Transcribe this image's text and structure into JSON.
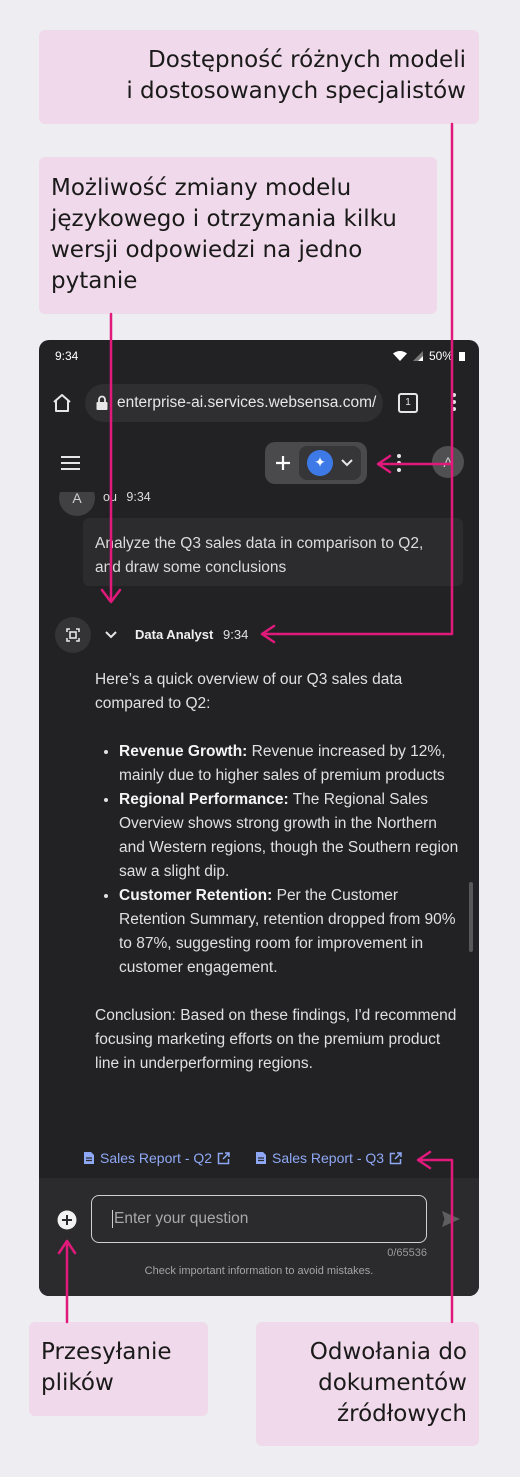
{
  "callouts": {
    "models": {
      "line1": "Dostępność różnych modeli",
      "line2": "i dostosowanych specjalistów"
    },
    "switch": {
      "line1": "Możliwość zmiany modelu",
      "line2": "językowego i otrzymania kilku",
      "line3": "wersji odpowiedzi na jedno",
      "line4": "pytanie"
    },
    "upload": {
      "line1": "Przesyłanie",
      "line2": "plików"
    },
    "sources": {
      "line1": "Odwołania do",
      "line2": "dokumentów",
      "line3": "źródłowych"
    }
  },
  "status_bar": {
    "time": "9:34",
    "battery": "50%"
  },
  "browser": {
    "url": "enterprise-ai.services.websensa.com/",
    "tab_count": "1"
  },
  "header": {
    "avatar_initial": "A"
  },
  "chat": {
    "user": {
      "avatar_initial": "A",
      "name_fragment": "ou",
      "time": "9:34",
      "message": "Analyze the Q3 sales data in comparison to Q2, and draw some conclusions"
    },
    "agent": {
      "name": "Data Analyst",
      "time": "9:34",
      "intro": "Here’s a quick overview of our Q3 sales data compared to Q2:",
      "bullets": [
        {
          "title": "Revenue Growth:",
          "text": " Revenue increased by 12%, mainly due to higher sales of premium products"
        },
        {
          "title": "Regional Performance:",
          "text": " The Regional Sales Overview shows strong growth in the Northern and Western regions, though the Southern region saw a slight dip."
        },
        {
          "title": "Customer Retention:",
          "text": " Per the Customer Retention Summary, retention dropped from 90% to 87%, suggesting room for improvement in customer engagement."
        }
      ],
      "conclusion": "Conclusion: Based on these findings, I'd recommend focusing marketing efforts on the premium product line in underperforming regions.",
      "references": [
        "Sales Report - Q2",
        "Sales Report - Q3"
      ]
    }
  },
  "composer": {
    "placeholder": "Enter your question",
    "counter": "0/65536",
    "disclaimer": "Check important information to avoid mistakes."
  },
  "colors": {
    "accent_arrow": "#e0197b",
    "link": "#8fa8f5",
    "model_button": "#3d7ae8",
    "callout_bg": "#f0d9ea"
  }
}
